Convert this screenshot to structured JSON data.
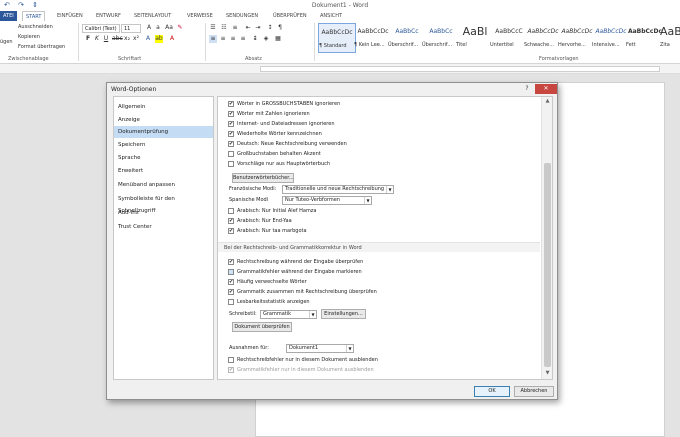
{
  "window": {
    "doc_title": "Dokument1 - Word",
    "quick_access": "↶ ↷ ⇕"
  },
  "tabs": [
    {
      "label": "ATEI"
    },
    {
      "label": "START"
    },
    {
      "label": "EINFÜGEN"
    },
    {
      "label": "ENTWURF"
    },
    {
      "label": "SEITENLAYOUT"
    },
    {
      "label": "VERWEISE"
    },
    {
      "label": "SENDUNGEN"
    },
    {
      "label": "ÜBERPRÜFEN"
    },
    {
      "label": "ANSICHT"
    }
  ],
  "ribbon": {
    "clipboard": {
      "paste": "ügen",
      "cut": "Ausschneiden",
      "copy": "Kopieren",
      "format_painter": "Format übertragen",
      "group_label": "Zwischenablage"
    },
    "font": {
      "family": "Calibri (Text)",
      "size": "11",
      "group_label": "Schriftart"
    },
    "paragraph": {
      "group_label": "Absatz"
    },
    "styles": {
      "group_label": "Formatvorlagen",
      "items": [
        {
          "sample": "AaBbCcDc",
          "label": "¶ Standard"
        },
        {
          "sample": "AaBbCcDc",
          "label": "¶ Kein Lee..."
        },
        {
          "sample": "AaBbCc",
          "label": "Überschrif..."
        },
        {
          "sample": "AaBbCc",
          "label": "Überschrif..."
        },
        {
          "sample": "AaBl",
          "label": "Titel"
        },
        {
          "sample": "AaBbCcC",
          "label": "Untertitel"
        },
        {
          "sample": "AaBbCcDc",
          "label": "Schwache..."
        },
        {
          "sample": "AaBbCcDc",
          "label": "Hervorhe..."
        },
        {
          "sample": "AaBbCcDc",
          "label": "Intensive..."
        },
        {
          "sample": "AaBbCcDc",
          "label": "Fett"
        },
        {
          "sample": "AaBl",
          "label": "Zita"
        }
      ]
    }
  },
  "dialog": {
    "title": "Word-Optionen",
    "help": "?",
    "close": "✕",
    "nav": [
      {
        "label": "Allgemein",
        "selected": false
      },
      {
        "label": "Anzeige",
        "selected": false
      },
      {
        "label": "Dokumentprüfung",
        "selected": true
      },
      {
        "label": "Speichern",
        "selected": false
      },
      {
        "label": "Sprache",
        "selected": false
      },
      {
        "label": "Erweitert",
        "selected": false
      },
      {
        "label": "Menüband anpassen",
        "selected": false
      },
      {
        "label": "Symbolleiste für den Schnellzugriff",
        "selected": false
      },
      {
        "label": "Add-Ins",
        "selected": false
      },
      {
        "label": "Trust Center",
        "selected": false
      }
    ],
    "options_top": [
      {
        "label": "Wörter in GROSSBUCHSTABEN ignorieren",
        "checked": true
      },
      {
        "label": "Wörter mit Zahlen ignorieren",
        "checked": true
      },
      {
        "label": "Internet- und Dateiadressen ignorieren",
        "checked": true
      },
      {
        "label": "Wiederholte Wörter kennzeichnen",
        "checked": true
      },
      {
        "label": "Deutsch: Neue Rechtschreibung verwenden",
        "checked": true
      },
      {
        "label": "Großbuchstaben behalten Akzent",
        "checked": false
      },
      {
        "label": "Vorschläge nur aus Hauptwörterbuch",
        "checked": false
      }
    ],
    "custom_dictionaries_button": "Benutzerwörterbücher...",
    "french_modes_label": "Französische Modi:",
    "french_modes_value": "Traditionelle und neue Rechtschreibung",
    "spanish_modes_label": "Spanische Modi",
    "spanish_modes_value": "Nur Tuteo-Verbformen",
    "arabic_options": [
      {
        "label": "Arabisch: Nur Initial Alef Hamza",
        "checked": false
      },
      {
        "label": "Arabisch: Nur End-Yaa",
        "checked": true
      },
      {
        "label": "Arabisch: Nur taa marbgota",
        "checked": true
      }
    ],
    "word_section_title": "Bei der Rechtschreib- und Grammatikkorrektur in Word",
    "word_options": [
      {
        "label": "Rechtschreibung während der Eingabe überprüfen",
        "checked": true
      },
      {
        "label": "Grammatikfehler während der Eingabe markieren",
        "checked": false
      },
      {
        "label": "Häufig verwechselte Wörter",
        "checked": true
      },
      {
        "label": "Grammatik zusammen mit Rechtschreibung überprüfen",
        "checked": true
      },
      {
        "label": "Lesbarkeitsstatistik anzeigen",
        "checked": false
      }
    ],
    "writing_style_label": "Schreibstil:",
    "writing_style_value": "Grammatik",
    "settings_button": "Einstellungen...",
    "check_document_button": "Dokument überprüfen",
    "exceptions_label": "Ausnahmen für:",
    "exceptions_value": "Dokument1",
    "exception_options": [
      {
        "label": "Rechtschreibfehler nur in diesem Dokument ausblenden",
        "checked": false,
        "disabled": false
      },
      {
        "label": "Grammatikfehler nur in diesem Dokument ausblenden",
        "checked": true,
        "disabled": true
      }
    ],
    "ok_button": "OK",
    "cancel_button": "Abbrechen"
  }
}
